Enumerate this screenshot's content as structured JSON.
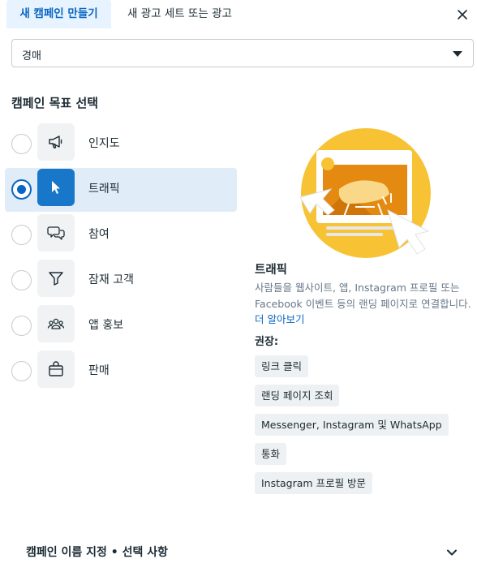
{
  "tabs": [
    {
      "label": "새 캠페인 만들기",
      "active": true
    },
    {
      "label": "새 광고 세트 또는 광고",
      "active": false
    }
  ],
  "buying_type": {
    "value": "경매"
  },
  "objectives_heading": "캠페인 목표 선택",
  "objectives": [
    {
      "label": "인지도",
      "icon": "megaphone-icon",
      "selected": false
    },
    {
      "label": "트래픽",
      "icon": "cursor-icon",
      "selected": true
    },
    {
      "label": "참여",
      "icon": "chat-bubbles-icon",
      "selected": false
    },
    {
      "label": "잠재 고객",
      "icon": "filter-icon",
      "selected": false
    },
    {
      "label": "앱 홍보",
      "icon": "people-icon",
      "selected": false
    },
    {
      "label": "판매",
      "icon": "shopping-bag-icon",
      "selected": false
    }
  ],
  "detail": {
    "title": "트래픽",
    "description": "사람들을 웹사이트, 앱, Instagram 프로필 또는 Facebook 이벤트 등의 랜딩 페이지로 연결합니다.",
    "learn_more": "더 알아보기",
    "recommended_label": "권장:",
    "recommended": [
      "링크 클릭",
      "랜딩 페이지 조회",
      "Messenger, Instagram 및 WhatsApp",
      "통화",
      "Instagram 프로필 방문"
    ]
  },
  "footer": {
    "label": "캠페인 이름 지정 • 선택 사항"
  },
  "colors": {
    "accent": "#0a66c2",
    "selected_row_bg": "#e0edf8",
    "illustration_yellow": "#f7c335",
    "illustration_orange": "#e48a10"
  }
}
